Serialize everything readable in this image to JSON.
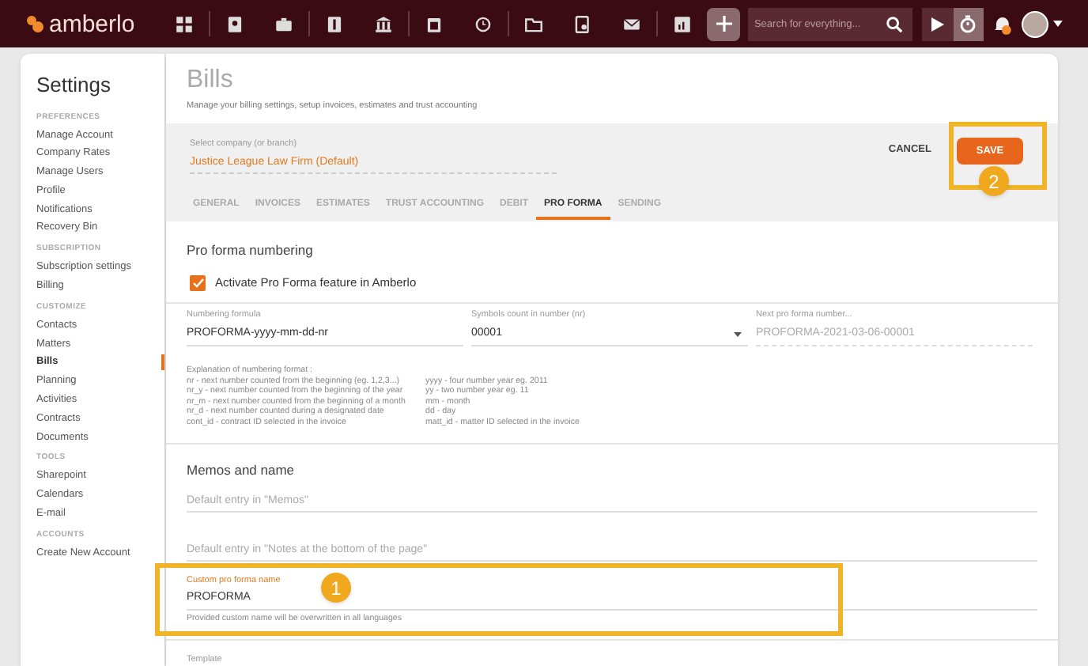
{
  "topbar": {
    "logo": "amberlo",
    "search": {
      "placeholder": "Search for everything..."
    }
  },
  "sidebar": {
    "title": "Settings",
    "sections": [
      {
        "heading": "PREFERENCES",
        "items": [
          {
            "label": "Manage Account",
            "selected": false
          },
          {
            "label": "Company Rates",
            "selected": false
          },
          {
            "label": "Manage Users",
            "selected": false
          },
          {
            "label": "Profile",
            "selected": false
          },
          {
            "label": "Notifications",
            "selected": false
          },
          {
            "label": "Recovery Bin",
            "selected": false
          }
        ]
      },
      {
        "heading": "SUBSCRIPTION",
        "items": [
          {
            "label": "Subscription settings",
            "selected": false
          },
          {
            "label": "Billing",
            "selected": false
          }
        ]
      },
      {
        "heading": "CUSTOMIZE",
        "items": [
          {
            "label": "Contacts",
            "selected": false
          },
          {
            "label": "Matters",
            "selected": false
          },
          {
            "label": "Bills",
            "selected": true
          },
          {
            "label": "Planning",
            "selected": false
          },
          {
            "label": "Activities",
            "selected": false
          },
          {
            "label": "Contracts",
            "selected": false
          },
          {
            "label": "Documents",
            "selected": false
          }
        ]
      },
      {
        "heading": "TOOLS",
        "items": [
          {
            "label": "Sharepoint",
            "selected": false
          },
          {
            "label": "Calendars",
            "selected": false
          },
          {
            "label": "E-mail",
            "selected": false
          }
        ]
      },
      {
        "heading": "ACCOUNTS",
        "items": [
          {
            "label": "Create New Account",
            "selected": false
          }
        ]
      }
    ]
  },
  "page": {
    "title": "Bills",
    "subtitle": "Manage your billing settings, setup invoices, estimates and trust accounting",
    "company": {
      "label": "Select company (or branch)",
      "value": "Justice League Law Firm (Default)"
    },
    "buttons": {
      "cancel": "CANCEL",
      "save": "SAVE"
    },
    "tabs": [
      {
        "label": "GENERAL",
        "selected": false
      },
      {
        "label": "INVOICES",
        "selected": false
      },
      {
        "label": "ESTIMATES",
        "selected": false
      },
      {
        "label": "TRUST ACCOUNTING",
        "selected": false
      },
      {
        "label": "DEBIT",
        "selected": false
      },
      {
        "label": "PRO FORMA",
        "selected": true
      },
      {
        "label": "SENDING",
        "selected": false
      }
    ],
    "numbering": {
      "heading": "Pro forma numbering",
      "activate": {
        "label": "Activate Pro Forma feature in Amberlo",
        "checked": true
      },
      "fields": [
        {
          "label": "Numbering formula",
          "value": "PROFORMA-yyyy-mm-dd-nr",
          "kind": "text"
        },
        {
          "label": "Symbols count in number (nr)",
          "value": "00001",
          "kind": "select"
        },
        {
          "label": "Next pro forma number...",
          "placeholder": "PROFORMA-2021-03-06-00001",
          "kind": "readonly"
        }
      ],
      "explanation_title": "Explanation of numbering format :",
      "explanation_left": [
        "nr - next number counted from the beginning (eg. 1,2,3...)",
        "nr_y - next number counted from the beginning of the year",
        "nr_m - next number counted from the beginning of a month",
        "nr_d - next number counted during a designated date",
        "cont_id - contract ID selected in the invoice"
      ],
      "explanation_right": [
        "yyyy - four number year eg. 2011",
        "yy - two number year eg. 11",
        "mm - month",
        "dd - day",
        "matt_id - matter ID selected in the invoice"
      ]
    },
    "memos": {
      "heading": "Memos and name",
      "memo_placeholder": "Default entry in \"Memos\"",
      "notes_placeholder": "Default entry in \"Notes at the bottom of the page\"",
      "custom_name": {
        "label": "Custom pro forma name",
        "value": "PROFORMA",
        "helper": "Provided custom name will be overwritten in all languages"
      },
      "template_label": "Template"
    }
  },
  "callouts": [
    {
      "label": "1"
    },
    {
      "label": "2"
    }
  ]
}
